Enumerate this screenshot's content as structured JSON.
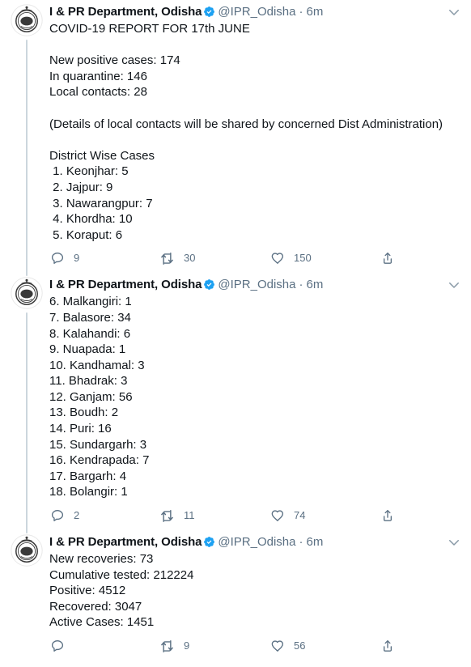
{
  "app": {
    "accent_color": "#1da1f2",
    "text_color": "#0f1419",
    "muted_color": "#5b7083",
    "thread_line_color": "#ccd6dd"
  },
  "icons": {
    "verified": "verified-badge-icon",
    "caret": "chevron-down-icon",
    "reply": "reply-icon",
    "retweet": "retweet-icon",
    "like": "heart-icon",
    "share": "share-icon",
    "avatar": "odisha-government-seal-avatar"
  },
  "tweets": [
    {
      "display_name": "I & PR Department, Odisha",
      "handle": "@IPR_Odisha",
      "separator": "·",
      "timestamp": "6m",
      "verified": true,
      "body": "COVID-19 REPORT FOR 17th JUNE\n\nNew positive cases: 174\nIn quarantine: 146\nLocal contacts: 28\n\n(Details of local contacts will be shared by concerned Dist Administration)\n\nDistrict Wise Cases\n 1. Keonjhar: 5\n 2. Jajpur: 9\n 3. Nawarangpur: 7\n 4. Khordha: 10\n 5. Koraput: 6",
      "reply_count": "9",
      "retweet_count": "30",
      "like_count": "150",
      "has_thread_line": true
    },
    {
      "display_name": "I & PR Department, Odisha",
      "handle": "@IPR_Odisha",
      "separator": "·",
      "timestamp": "6m",
      "verified": true,
      "body": "6. Malkangiri: 1\n7. Balasore: 34\n8. Kalahandi: 6\n9. Nuapada: 1\n10. Kandhamal: 3\n11. Bhadrak: 3\n12. Ganjam: 56\n13. Boudh: 2\n14. Puri: 16\n15. Sundargarh: 3\n16. Kendrapada: 7\n17. Bargarh: 4\n18. Bolangir: 1",
      "reply_count": "2",
      "retweet_count": "11",
      "like_count": "74",
      "has_thread_line": true
    },
    {
      "display_name": "I & PR Department, Odisha",
      "handle": "@IPR_Odisha",
      "separator": "·",
      "timestamp": "6m",
      "verified": true,
      "body": "New recoveries: 73\nCumulative tested: 212224\nPositive: 4512\nRecovered: 3047\nActive Cases: 1451",
      "reply_count": "",
      "retweet_count": "9",
      "like_count": "56",
      "has_thread_line": false
    }
  ]
}
